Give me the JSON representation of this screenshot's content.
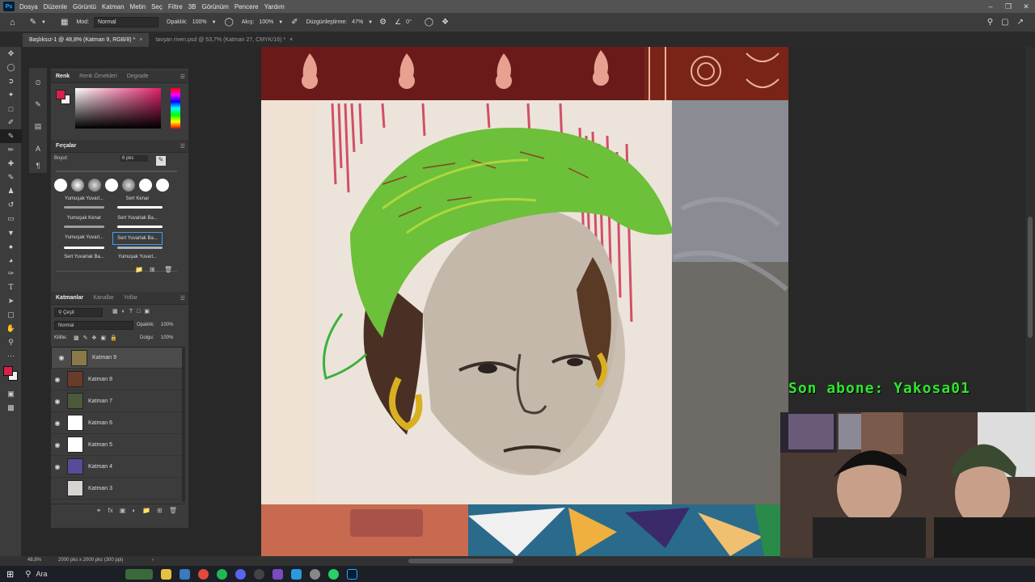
{
  "app": {
    "name": "Ps"
  },
  "menu": [
    "Dosya",
    "Düzenle",
    "Görüntü",
    "Katman",
    "Metin",
    "Seç",
    "Filtre",
    "3B",
    "Görünüm",
    "Pencere",
    "Yardım"
  ],
  "options": {
    "mode_label": "Mod:",
    "mode_value": "Normal",
    "opacity_label": "Opaklık:",
    "opacity_value": "100%",
    "flow_label": "Akış:",
    "flow_value": "100%",
    "smoothing_label": "Düzgünleştirme:",
    "smoothing_value": "47%",
    "angle_value": "0°"
  },
  "tabs": [
    {
      "label": "Başlıksız-1 @ 48,8% (Katman 9, RGB/8) *",
      "active": true
    },
    {
      "label": "tavşan riven.psd @ 53,7% (Katman 27, CMYK/16) *",
      "active": false
    }
  ],
  "color_panel": {
    "tabs": [
      "Renk",
      "Renk Örnekleri",
      "Degrade"
    ],
    "foreground": "#d8204a",
    "background": "#f0f0f0"
  },
  "brushes_panel": {
    "title": "Fırçalar",
    "size_label": "Boyut:",
    "size_value": "6 pks",
    "items": [
      "Yumuşak Yuvarl...",
      "Sert Kenar",
      "Yumuşak Kenar",
      "Sert Yuvarlak Ba...",
      "Yumuşak Yuvarl...",
      "Sert Yuvarlak Ba...",
      "Sert Yuvarlak Ba...",
      "Yumuşak Yuvarl..."
    ]
  },
  "layers_panel": {
    "tabs": [
      "Katmanlar",
      "Kanallar",
      "Yollar"
    ],
    "filter_label": "Çeşit",
    "blend_mode": "Normal",
    "opacity_label": "Opaklık:",
    "opacity_value": "100%",
    "lock_label": "Kilitle:",
    "fill_label": "Dolgu:",
    "fill_value": "100%",
    "layers": [
      {
        "name": "Katman 9",
        "visible": true,
        "selected": true,
        "thumb": "#8a7a4a"
      },
      {
        "name": "Katman 8",
        "visible": true,
        "selected": false,
        "thumb": "#6a3a2a"
      },
      {
        "name": "Katman 7",
        "visible": true,
        "selected": false,
        "thumb": "#4a5a3a"
      },
      {
        "name": "Katman 6",
        "visible": true,
        "selected": false,
        "thumb": "#ffffff"
      },
      {
        "name": "Katman 5",
        "visible": true,
        "selected": false,
        "thumb": "#ffffff"
      },
      {
        "name": "Katman 4",
        "visible": true,
        "selected": false,
        "thumb": "#5a4a9a"
      },
      {
        "name": "Katman 3",
        "visible": false,
        "selected": false,
        "thumb": "#d8d4d0"
      }
    ]
  },
  "status": {
    "zoom": "48,8%",
    "doc_info": "2000 pks x 2000 pks (300 ppi)"
  },
  "taskbar": {
    "search_label": "Ara"
  },
  "overlay": {
    "subscriber_text": "Son abone: Yakosa01"
  }
}
